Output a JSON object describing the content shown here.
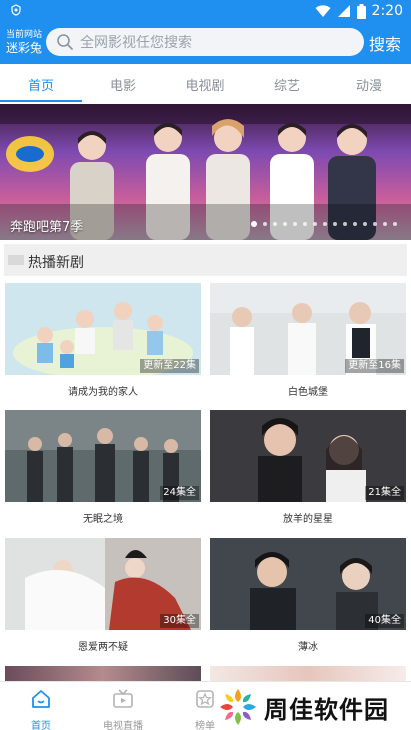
{
  "status_bar": {
    "time": "2:20"
  },
  "header": {
    "app_name_small": "当前网站",
    "app_name_big": "迷彩兔",
    "search_placeholder": "全网影视任您搜索",
    "search_button": "搜索"
  },
  "tabs": [
    {
      "label": "首页",
      "active": true
    },
    {
      "label": "电影",
      "active": false
    },
    {
      "label": "电视剧",
      "active": false
    },
    {
      "label": "综艺",
      "active": false
    },
    {
      "label": "动漫",
      "active": false
    }
  ],
  "hero": {
    "title": "奔跑吧第7季",
    "dot_count": 15,
    "active_dot": 0
  },
  "section": {
    "title": "热播新剧"
  },
  "cards": [
    {
      "title": "请成为我的家人",
      "badge": "更新至22集"
    },
    {
      "title": "白色城堡",
      "badge": "更新至16集"
    },
    {
      "title": "无眠之境",
      "badge": "24集全"
    },
    {
      "title": "放羊的星星",
      "badge": "21集全"
    },
    {
      "title": "恩爱两不疑",
      "badge": "30集全"
    },
    {
      "title": "薄冰",
      "badge": "40集全"
    }
  ],
  "bottom_nav": [
    {
      "label": "首页",
      "icon": "home-icon",
      "active": true
    },
    {
      "label": "电视直播",
      "icon": "tv-icon",
      "active": false
    },
    {
      "label": "榜单",
      "icon": "star-icon",
      "active": false
    }
  ],
  "watermark": {
    "text": "周佳软件园"
  },
  "colors": {
    "primary": "#1f8ff0",
    "background": "#ffffff"
  }
}
